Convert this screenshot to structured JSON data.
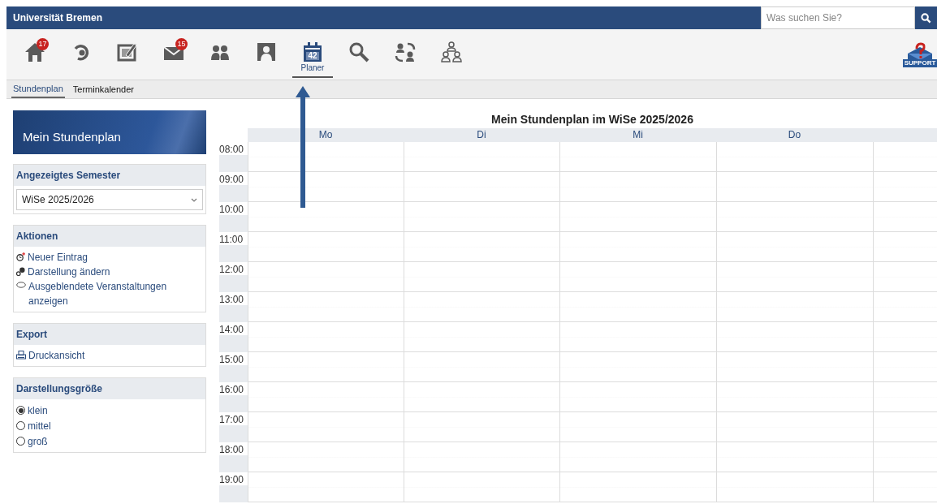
{
  "header": {
    "title": "Universität Bremen",
    "search": {
      "placeholder": "Was suchen Sie?"
    }
  },
  "nav": [
    {
      "kind": "home",
      "badge": "17",
      "selected": false
    },
    {
      "kind": "refresh",
      "selected": false
    },
    {
      "kind": "edit",
      "selected": false
    },
    {
      "kind": "mail",
      "badge": "15",
      "selected": false
    },
    {
      "kind": "group",
      "selected": false
    },
    {
      "kind": "person",
      "selected": false
    },
    {
      "kind": "calendar",
      "icon_text": "42",
      "label": "Planer",
      "selected": true
    },
    {
      "kind": "search",
      "selected": false
    },
    {
      "kind": "exchange",
      "selected": false
    },
    {
      "kind": "org",
      "selected": false
    }
  ],
  "support": "SUPPORT",
  "subtabs": [
    {
      "label": "Stundenplan",
      "selected": true
    },
    {
      "label": "Terminkalender",
      "selected": false
    }
  ],
  "sidebar": {
    "title": "Mein Stundenplan",
    "semester": {
      "heading": "Angezeigtes Semester",
      "value": "WiSe 2025/2026"
    },
    "actions": {
      "heading": "Aktionen",
      "items": [
        {
          "kind": "new",
          "label": "Neuer Eintrag"
        },
        {
          "kind": "settings",
          "label": "Darstellung ändern"
        },
        {
          "kind": "eye",
          "label": "Ausgeblendete Veranstaltungen anzeigen"
        }
      ]
    },
    "export": {
      "heading": "Export",
      "items": [
        {
          "kind": "print",
          "label": "Druckansicht"
        }
      ]
    },
    "size": {
      "heading": "Darstellungsgröße",
      "options": [
        {
          "label": "klein",
          "selected": true
        },
        {
          "label": "mittel",
          "selected": false
        },
        {
          "label": "groß",
          "selected": false
        }
      ]
    }
  },
  "calendar": {
    "title": "Mein Stundenplan im WiSe 2025/2026",
    "days": [
      "Mo",
      "Di",
      "Mi",
      "Do"
    ],
    "times": [
      "08:00",
      "09:00",
      "10:00",
      "11:00",
      "12:00",
      "13:00",
      "14:00",
      "15:00",
      "16:00",
      "17:00",
      "18:00",
      "19:00"
    ]
  }
}
